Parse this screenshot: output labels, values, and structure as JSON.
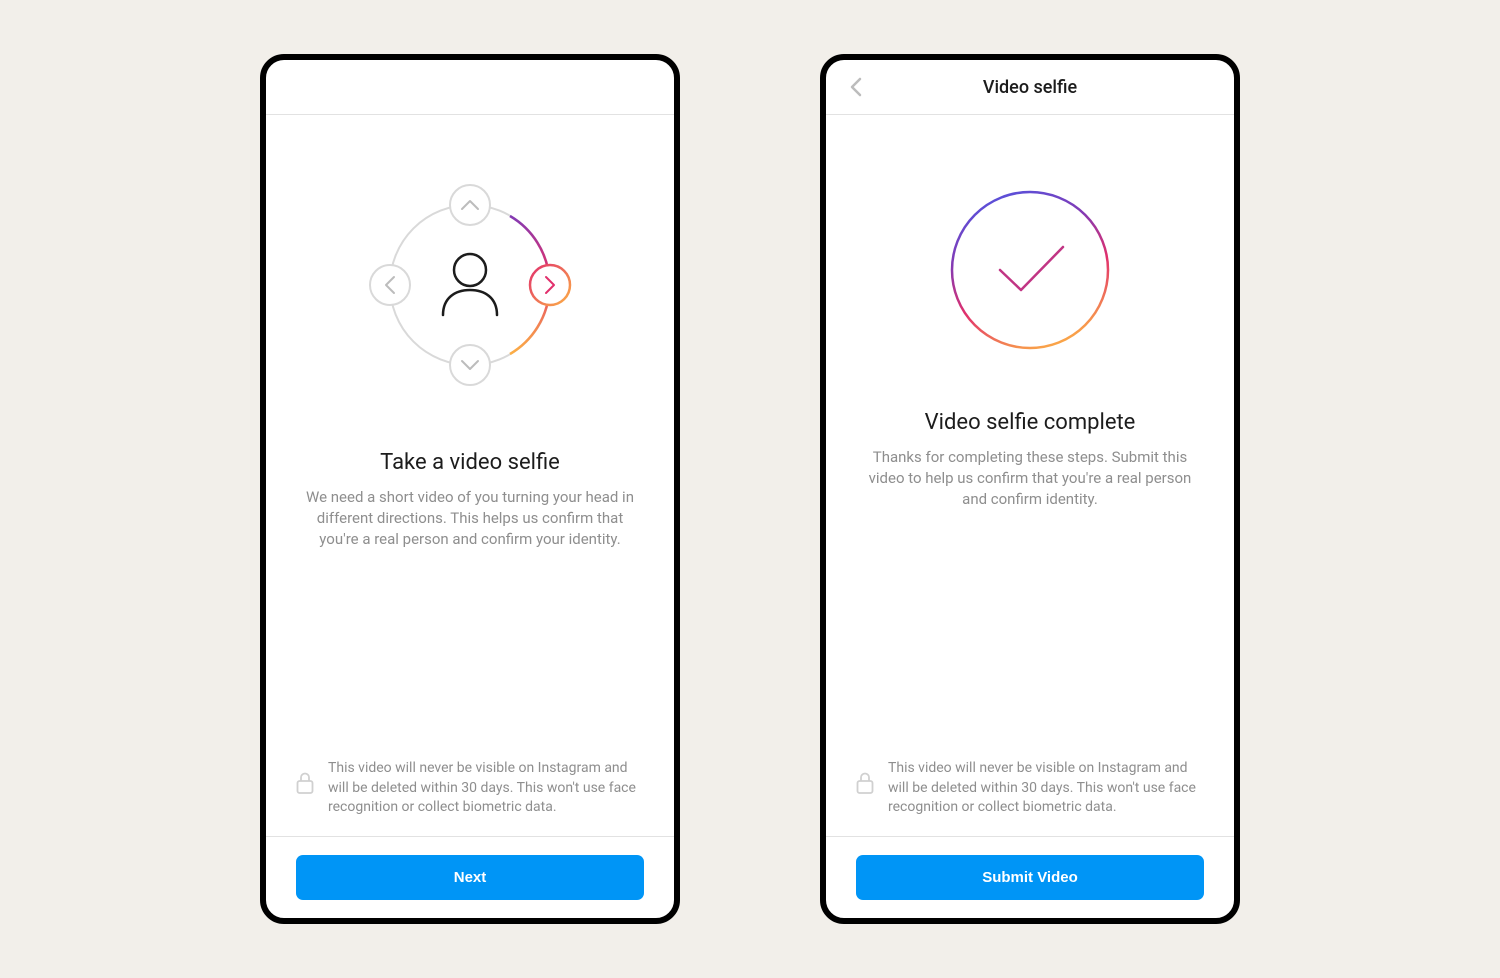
{
  "screen1": {
    "title": "Take a video selfie",
    "subtitle": "We need a short video of you turning your head in different directions. This helps us confirm that you're a real person and confirm your identity.",
    "privacy": "This video will never be visible on Instagram and will be deleted within 30 days. This won't use face recognition or collect biometric data.",
    "button": "Next"
  },
  "screen2": {
    "header": "Video selfie",
    "title": "Video selfie complete",
    "subtitle": "Thanks for completing these steps. Submit this video to help us confirm that you're a real person and confirm identity.",
    "privacy": "This video will never be visible on Instagram and will be deleted within 30 days. This won't use face recognition or collect biometric data.",
    "button": "Submit Video"
  }
}
